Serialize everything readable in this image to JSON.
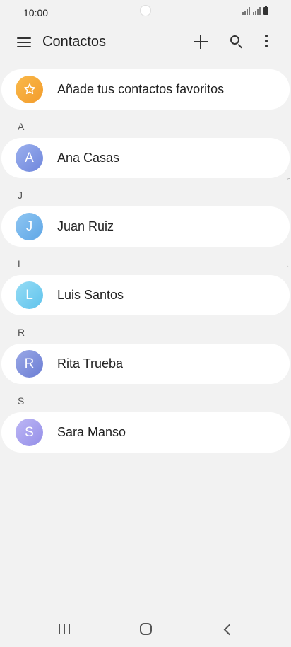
{
  "status_bar": {
    "time": "10:00"
  },
  "app_bar": {
    "title": "Contactos"
  },
  "favorites": {
    "label": "Añade tus contactos favoritos"
  },
  "sections": [
    {
      "letter": "A",
      "contact": {
        "initial": "A",
        "name": "Ana Casas",
        "color": "#7f98e6"
      }
    },
    {
      "letter": "J",
      "contact": {
        "initial": "J",
        "name": "Juan Ruiz",
        "color": "#73b6ec"
      }
    },
    {
      "letter": "L",
      "contact": {
        "initial": "L",
        "name": "Luis Santos",
        "color": "#76cff0"
      }
    },
    {
      "letter": "R",
      "contact": {
        "initial": "R",
        "name": "Rita Trueba",
        "color": "#7d8fdc"
      }
    },
    {
      "letter": "S",
      "contact": {
        "initial": "S",
        "name": "Sara Manso",
        "color": "#a8a2f0"
      }
    }
  ],
  "colors": {
    "favorites_avatar": "#f5a73a",
    "background": "#f2f2f2",
    "card": "#ffffff"
  },
  "icons": [
    "menu-icon",
    "add-icon",
    "search-icon",
    "more-options-icon",
    "star-icon",
    "recent-apps-icon",
    "home-icon",
    "back-icon"
  ]
}
